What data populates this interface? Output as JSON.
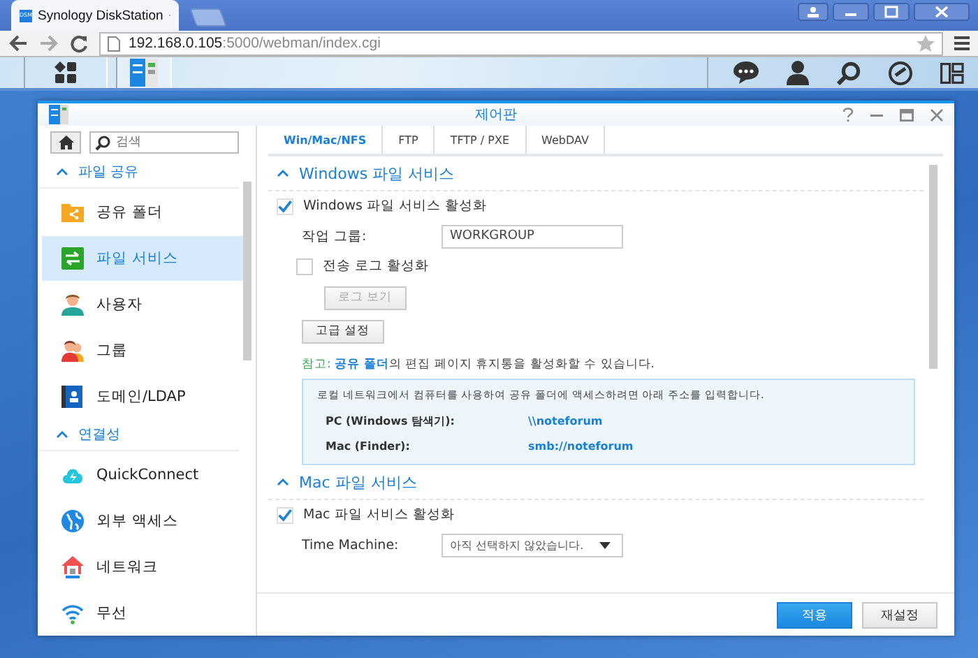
{
  "browser": {
    "tab_title": "Synology  DiskStation",
    "favicon_text": "DSM",
    "url_host": "192.168.0.105",
    "url_path": ":5000/webman/index.cgi"
  },
  "window": {
    "title": "제어판"
  },
  "sidebar": {
    "search_placeholder": "검색",
    "sections": [
      {
        "title": "파일 공유",
        "expanded": true,
        "items": [
          {
            "label": "공유 폴더",
            "kind": "folder",
            "selected": false
          },
          {
            "label": "파일 서비스",
            "kind": "service",
            "selected": true
          },
          {
            "label": "사용자",
            "kind": "user",
            "selected": false
          },
          {
            "label": "그룹",
            "kind": "group",
            "selected": false
          },
          {
            "label": "도메인/LDAP",
            "kind": "domain",
            "selected": false
          }
        ]
      },
      {
        "title": "연결성",
        "expanded": true,
        "items": [
          {
            "label": "QuickConnect",
            "kind": "cloud",
            "selected": false
          },
          {
            "label": "외부 액세스",
            "kind": "globe",
            "selected": false
          },
          {
            "label": "네트워크",
            "kind": "house",
            "selected": false
          },
          {
            "label": "무선",
            "kind": "wifi",
            "selected": false
          }
        ]
      }
    ]
  },
  "tabs": [
    {
      "label": "Win/Mac/NFS",
      "selected": true
    },
    {
      "label": "FTP",
      "selected": false
    },
    {
      "label": "TFTP / PXE",
      "selected": false
    },
    {
      "label": "WebDAV",
      "selected": false
    }
  ],
  "windows_service": {
    "title": "Windows 파일 서비스",
    "expanded": true,
    "enable": {
      "label": "Windows 파일 서비스 활성화",
      "checked": true
    },
    "workgroup": {
      "label": "작업 그룹:",
      "value": "WORKGROUP"
    },
    "transfer_log": {
      "label": "전송 로그 활성화",
      "checked": false
    },
    "view_log_button": {
      "label": "로그 보기",
      "disabled": true
    },
    "advanced_button": {
      "label": "고급 설정",
      "disabled": false
    },
    "note": {
      "label": "참고:",
      "link": "공유 폴더",
      "text": "의 편집 페이지 휴지통을 활성화할 수 있습니다."
    },
    "info": {
      "intro": "로컬 네트워크에서 컴퓨터를 사용하여 공유 폴더에 액세스하려면 아래 주소를 입력합니다.",
      "rows": [
        {
          "label": "PC (Windows 탐색기):",
          "value": "\\\\noteforum"
        },
        {
          "label": "Mac (Finder):",
          "value": "smb://noteforum"
        }
      ]
    }
  },
  "mac_service": {
    "title": "Mac 파일 서비스",
    "expanded": true,
    "enable": {
      "label": "Mac 파일 서비스 활성화",
      "checked": true
    },
    "time_machine": {
      "label": "Time Machine:",
      "value": "아직 선택하지 않았습니다."
    }
  },
  "footer": {
    "buttons": [
      {
        "label": "적용",
        "kind": "primary"
      },
      {
        "label": "재설정",
        "kind": "secondary"
      }
    ]
  }
}
